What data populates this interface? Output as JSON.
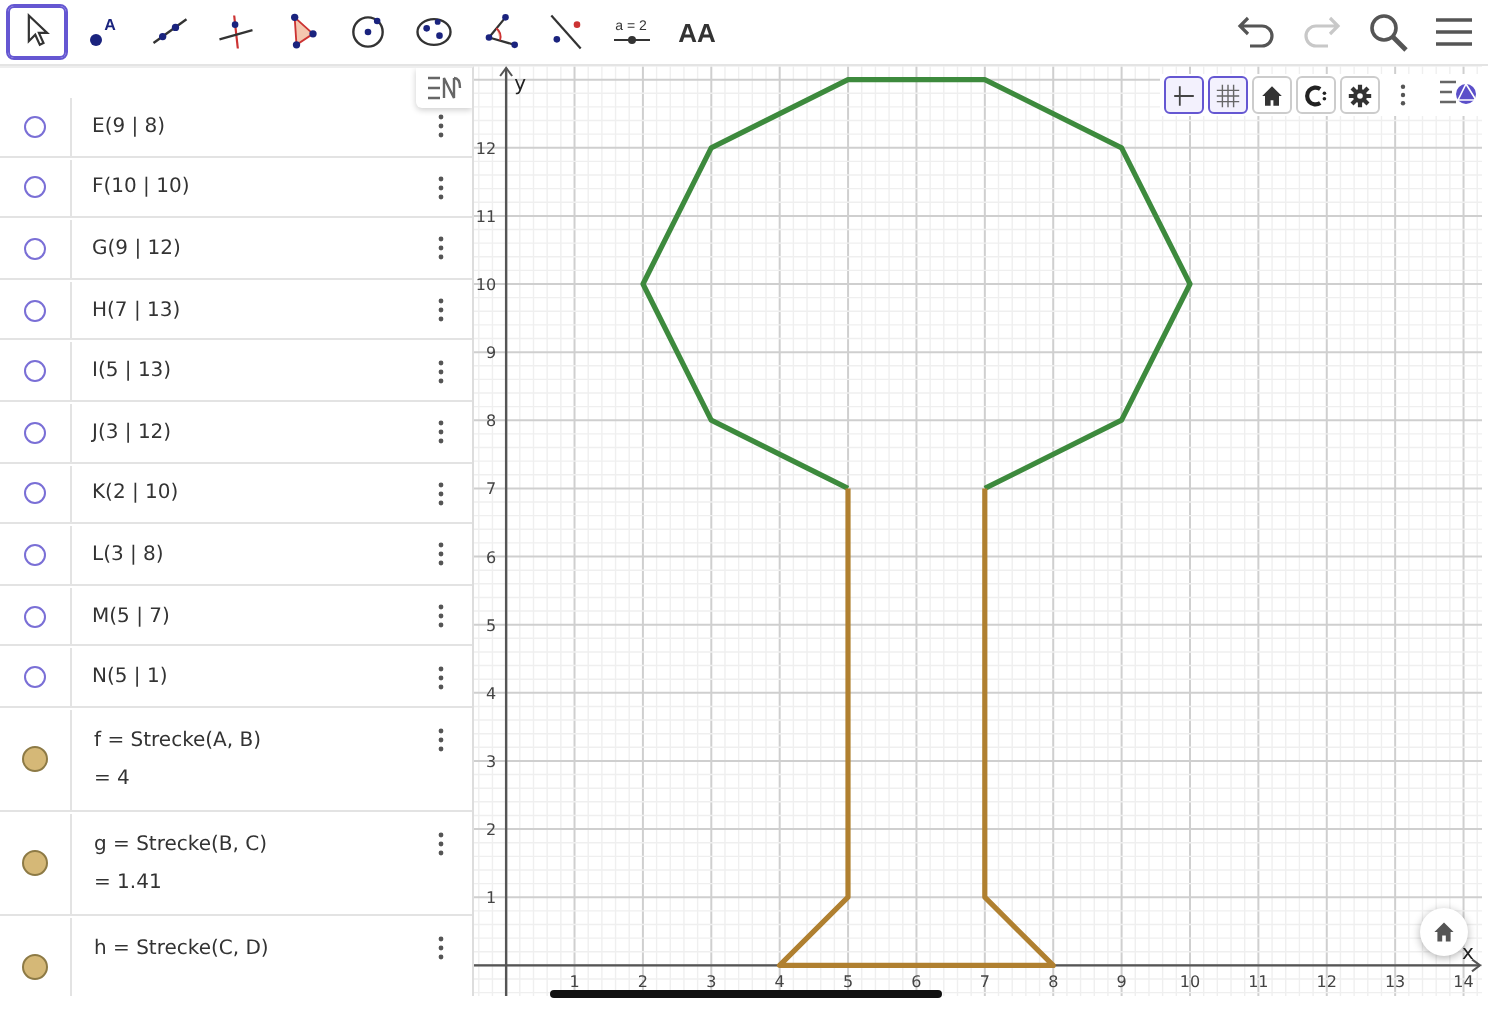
{
  "toolbar": {
    "tools": [
      {
        "kind": "move",
        "selected": true
      },
      {
        "kind": "point",
        "label": "A",
        "selected": false
      },
      {
        "kind": "line",
        "selected": false
      },
      {
        "kind": "perpendicular",
        "selected": false
      },
      {
        "kind": "polygon",
        "selected": false
      },
      {
        "kind": "circle",
        "selected": false
      },
      {
        "kind": "ellipse",
        "selected": false
      },
      {
        "kind": "angle",
        "selected": false
      },
      {
        "kind": "reflect",
        "selected": false
      },
      {
        "kind": "slider",
        "label": "a = 2",
        "selected": false
      },
      {
        "kind": "text",
        "label": "AA",
        "selected": false
      }
    ],
    "actions": [
      {
        "kind": "undo",
        "disabled": false
      },
      {
        "kind": "redo",
        "disabled": true
      },
      {
        "kind": "search",
        "disabled": false
      },
      {
        "kind": "menu",
        "disabled": false
      }
    ]
  },
  "algebra": {
    "items": [
      {
        "kind": "point",
        "text": "E(9 | 8)",
        "visible": false
      },
      {
        "kind": "point",
        "text": "F(10 | 10)",
        "visible": false
      },
      {
        "kind": "point",
        "text": "G(9 | 12)",
        "visible": false
      },
      {
        "kind": "point",
        "text": "H(7 | 13)",
        "visible": false
      },
      {
        "kind": "point",
        "text": "I(5 | 13)",
        "visible": false
      },
      {
        "kind": "point",
        "text": "J(3 | 12)",
        "visible": false
      },
      {
        "kind": "point",
        "text": "K(2 | 10)",
        "visible": false
      },
      {
        "kind": "point",
        "text": "L(3 | 8)",
        "visible": false
      },
      {
        "kind": "point",
        "text": "M(5 | 7)",
        "visible": false
      },
      {
        "kind": "point",
        "text": "N(5 | 1)",
        "visible": false
      },
      {
        "kind": "segment",
        "text": "f = Strecke(A, B)",
        "value": "= 4",
        "visible": true
      },
      {
        "kind": "segment",
        "text": "g = Strecke(B, C)",
        "value": "= 1.41",
        "visible": true
      },
      {
        "kind": "segment",
        "text": "h = Strecke(C, D)",
        "visible": true
      }
    ]
  },
  "style_bar": {
    "buttons": [
      {
        "kind": "axes",
        "selected": true
      },
      {
        "kind": "grid",
        "selected": true
      },
      {
        "kind": "home",
        "selected": false
      },
      {
        "kind": "view",
        "selected": false
      },
      {
        "kind": "settings",
        "selected": false
      }
    ]
  },
  "graphics": {
    "chart_data": {
      "type": "line",
      "grid": true,
      "xlabel": "x",
      "ylabel": "y",
      "xlim": [
        -0.47,
        14.27
      ],
      "ylim": [
        -0.45,
        13.2
      ],
      "xticks": [
        1,
        2,
        3,
        4,
        5,
        6,
        7,
        8,
        9,
        10,
        11,
        12,
        13,
        14
      ],
      "yticks": [
        1,
        2,
        3,
        4,
        5,
        6,
        7,
        8,
        9,
        10,
        11,
        12
      ],
      "series": [
        {
          "color": "#3d8a3d",
          "x": [
            5,
            3,
            2,
            3,
            5,
            7,
            9,
            10,
            9,
            7
          ],
          "values": [
            7,
            8,
            10,
            12,
            13,
            13,
            12,
            10,
            8,
            7
          ]
        },
        {
          "color": "#b08030",
          "x": [
            5,
            5,
            4,
            8,
            7,
            7
          ],
          "values": [
            7,
            1,
            0,
            0,
            1,
            7
          ]
        }
      ]
    }
  }
}
